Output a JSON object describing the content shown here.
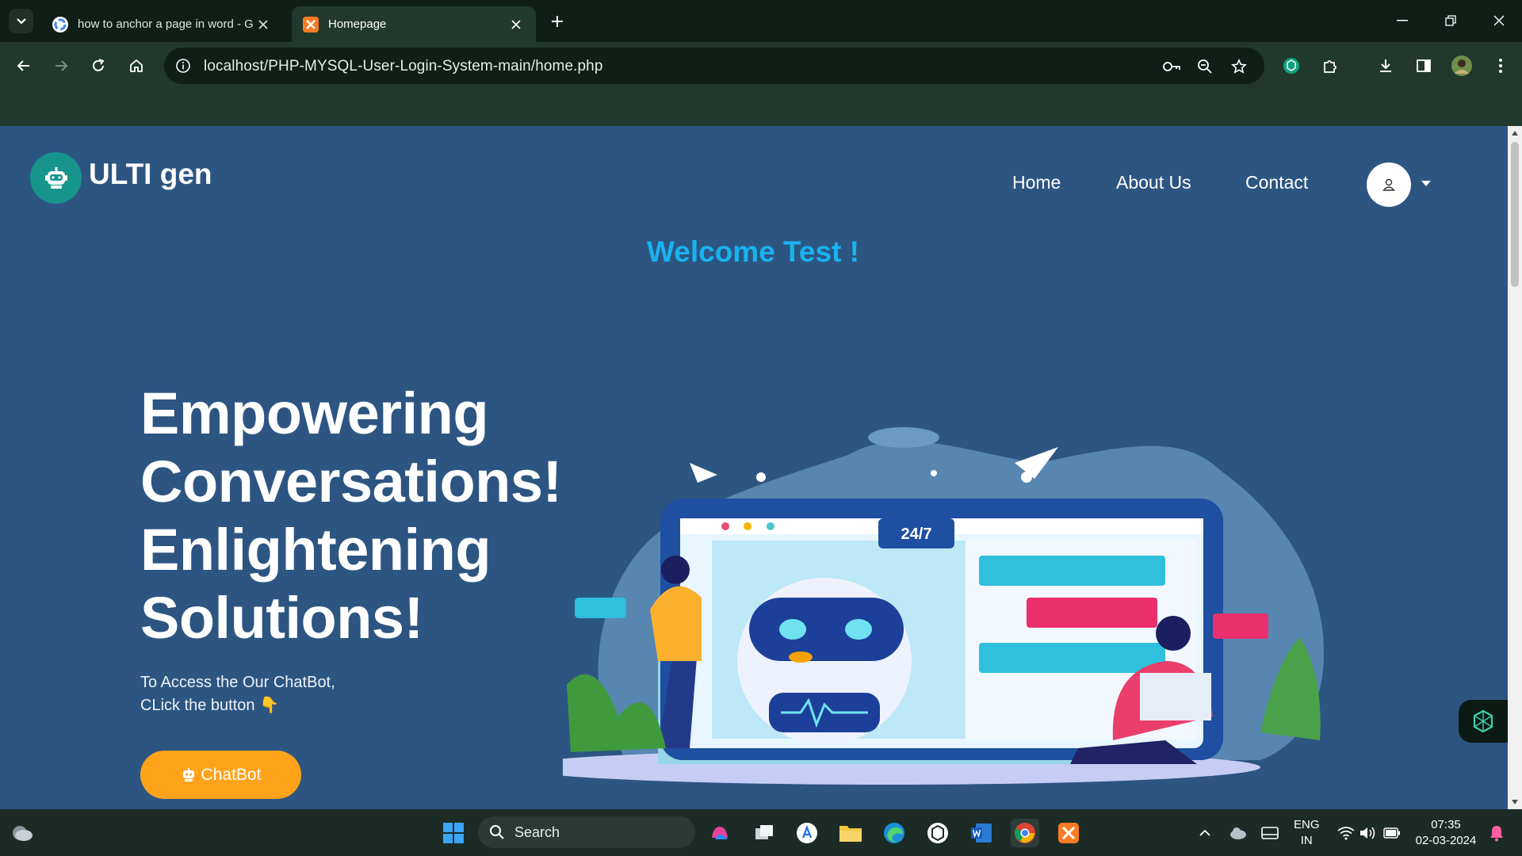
{
  "browser": {
    "tabs": [
      {
        "title": "how to anchor a page in word - G",
        "active": false
      },
      {
        "title": "Homepage",
        "active": true
      }
    ],
    "url": "localhost/PHP-MYSQL-User-Login-System-main/home.php"
  },
  "page": {
    "logo_text": "ULTI gen",
    "nav": [
      "Home",
      "About Us",
      "Contact"
    ],
    "welcome": "Welcome Test !",
    "headline": [
      "Empowering",
      "Conversations!",
      "Enlightening",
      "Solutions!"
    ],
    "subtext_line1": "To Access the Our ChatBot,",
    "subtext_line2": "CLick the button 👇",
    "chatbot_button": "ChatBot",
    "illustration_badge": "24/7"
  },
  "taskbar": {
    "search_placeholder": "Search",
    "lang_top": "ENG",
    "lang_bottom": "IN",
    "time": "07:35",
    "date": "02-03-2024"
  },
  "colors": {
    "page_bg": "#2d5582",
    "welcome": "#19b3f0",
    "accent_button": "#ffa31a",
    "logo_badge": "#17958c"
  }
}
